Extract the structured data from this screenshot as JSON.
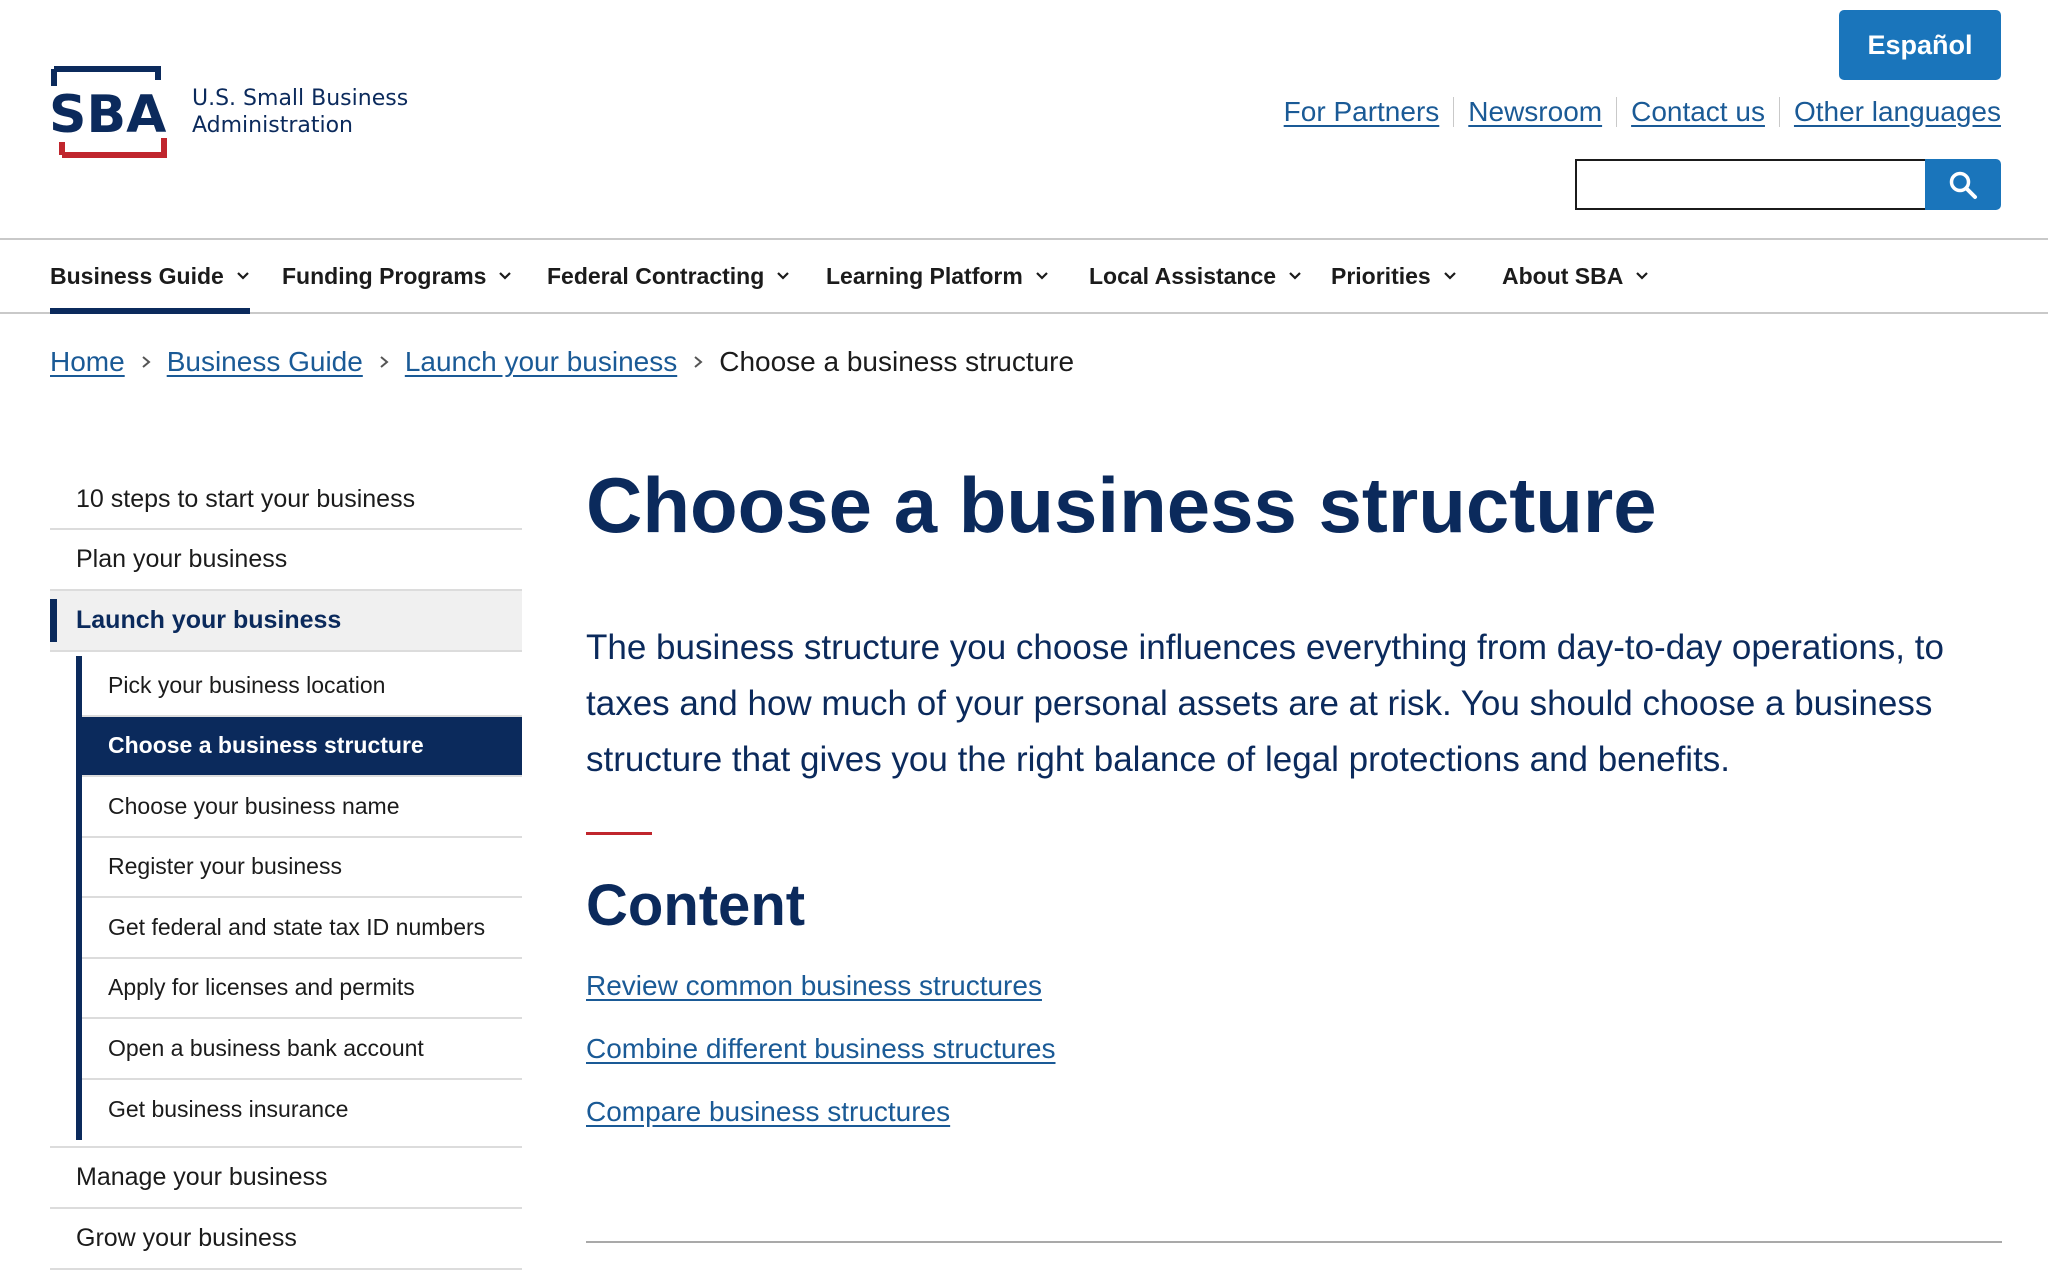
{
  "header": {
    "logo_text_line1": "U.S. Small Business",
    "logo_text_line2": "Administration",
    "logo_letters": "SBA",
    "espanol_label": "Español",
    "util_links": [
      "For Partners",
      "Newsroom",
      "Contact us",
      "Other languages"
    ],
    "search": {
      "value": "",
      "placeholder": ""
    }
  },
  "nav": {
    "items": [
      "Business Guide",
      "Funding Programs",
      "Federal Contracting",
      "Learning Platform",
      "Local Assistance",
      "Priorities",
      "About SBA"
    ],
    "active": "Business Guide"
  },
  "breadcrumb": {
    "links": [
      "Home",
      "Business Guide",
      "Launch your business"
    ],
    "current": "Choose a business structure"
  },
  "sidebar": {
    "top_before": [
      "10 steps to start your business",
      "Plan your business"
    ],
    "current_section": "Launch your business",
    "sub_items": [
      "Pick your business location",
      "Choose a business structure",
      "Choose your business name",
      "Register your business",
      "Get federal and state tax ID numbers",
      "Apply for licenses and permits",
      "Open a business bank account",
      "Get business insurance"
    ],
    "current_sub": "Choose a business structure",
    "top_after": [
      "Manage your business",
      "Grow your business"
    ]
  },
  "main": {
    "title": "Choose a business structure",
    "lead": "The business structure you choose influences everything from day-to-day operations, to taxes and how much of your personal assets are at risk. You should choose a business structure that gives you the right balance of legal protections and benefits.",
    "content_heading": "Content",
    "toc": [
      "Review common business structures",
      "Combine different business structures",
      "Compare business structures"
    ]
  },
  "colors": {
    "navy": "#0b2a5c",
    "link_blue": "#1a5a96",
    "button_blue": "#1a75bb",
    "accent_red": "#c0262d"
  }
}
